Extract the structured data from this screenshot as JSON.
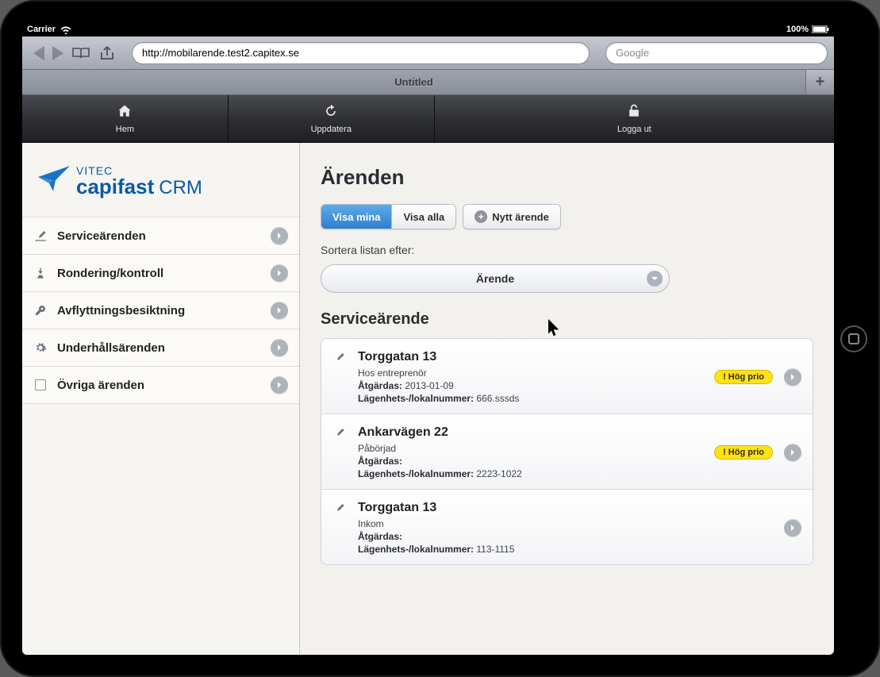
{
  "statusbar": {
    "carrier": "Carrier",
    "battery": "100%"
  },
  "browser": {
    "url": "http://mobilarende.test2.capitex.se",
    "search_placeholder": "Google",
    "tab_title": "Untitled",
    "add_tab": "+"
  },
  "app_header": {
    "home": "Hem",
    "refresh": "Uppdatera",
    "logout": "Logga ut"
  },
  "logo": {
    "line1": "VITEC",
    "line2a": "capifast",
    "line2b": "CRM"
  },
  "sidebar": {
    "items": [
      {
        "label": "Serviceärenden"
      },
      {
        "label": "Rondering/kontroll"
      },
      {
        "label": "Avflyttningsbesiktning"
      },
      {
        "label": "Underhållsärenden"
      },
      {
        "label": "Övriga ärenden"
      }
    ]
  },
  "content": {
    "title": "Ärenden",
    "filter_mine": "Visa mina",
    "filter_all": "Visa alla",
    "new_btn": "Nytt ärende",
    "sort_label": "Sortera listan efter:",
    "sort_value": "Ärende",
    "section_title": "Serviceärende",
    "meta_labels": {
      "fix": "Åtgärdas:",
      "unit": "Lägenhets-/lokalnummer:"
    },
    "badge_text": "! Hög prio",
    "cards": [
      {
        "title": "Torggatan 13",
        "status": "Hos entreprenör",
        "fix": "2013-01-09",
        "unit": "666.sssds",
        "prio": true
      },
      {
        "title": "Ankarvägen 22",
        "status": "Påbörjad",
        "fix": "",
        "unit": "2223-1022",
        "prio": true
      },
      {
        "title": "Torggatan 13",
        "status": "Inkom",
        "fix": "",
        "unit": "113-1115",
        "prio": false
      }
    ]
  }
}
